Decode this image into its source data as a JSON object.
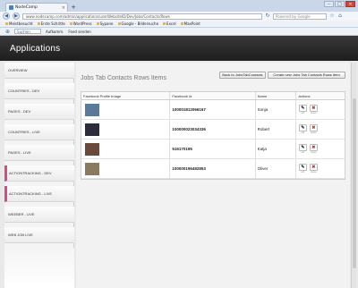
{
  "browser": {
    "tab_title": "NodeCamp",
    "tab_close": "×",
    "new_tab": "+",
    "window_buttons": [
      "–",
      "□",
      "×"
    ],
    "url": "www.nodecamp.com/admin/applications/userWebsiteID/Dev/Jobs/Contacts/Rows",
    "search_placeholder": "Powered by Google",
    "bookmarks": [
      "Meistbesucht",
      "Erste Schritte",
      "WordPress",
      "Sypane",
      "Google - Bildersuche",
      "Excel",
      "MaxPoint"
    ],
    "toolbar2": {
      "search_value": "Suchen",
      "items": [
        "Aufkomm.",
        "Feed senden"
      ]
    }
  },
  "app": {
    "title": "Applications"
  },
  "sidebar": {
    "items": [
      {
        "label": "OVERVIEW",
        "active": false
      },
      {
        "label": "COUNTRIES - DEV",
        "active": false
      },
      {
        "label": "PAGES - DEV",
        "active": false
      },
      {
        "label": "COUNTRIES - LIVE",
        "active": false
      },
      {
        "label": "PAGES - LIVE",
        "active": false
      },
      {
        "label": "ACTIONTRACKING - DEV",
        "active": true
      },
      {
        "label": "ACTIONTRACKING - LIVE",
        "active": true
      },
      {
        "label": "WEEBER - LIVE",
        "active": false
      },
      {
        "label": "WEB JOB LIVE",
        "active": false
      }
    ]
  },
  "main": {
    "title": "Jobs Tab Contacts Rows Items",
    "back_button": "Back to JobsTabContacts",
    "create_button": "Create new Jobs Tab Contacts Rows Item",
    "columns": [
      "Facebook Profile Image",
      "Facebook Id",
      "Name",
      "Actions"
    ],
    "rows": [
      {
        "facebook_id": "100001812066167",
        "name": "Sonja",
        "thumb_color": "#5a7a9a"
      },
      {
        "facebook_id": "100000023034336",
        "name": "Robert",
        "thumb_color": "#2c2c3a"
      },
      {
        "facebook_id": "516170195",
        "name": "Katja",
        "thumb_color": "#6a4a3a"
      },
      {
        "facebook_id": "100000196482853",
        "name": "Oliver",
        "thumb_color": "#8a7a60"
      }
    ],
    "action_labels": {
      "edit": "edit",
      "delete": "delete"
    }
  }
}
